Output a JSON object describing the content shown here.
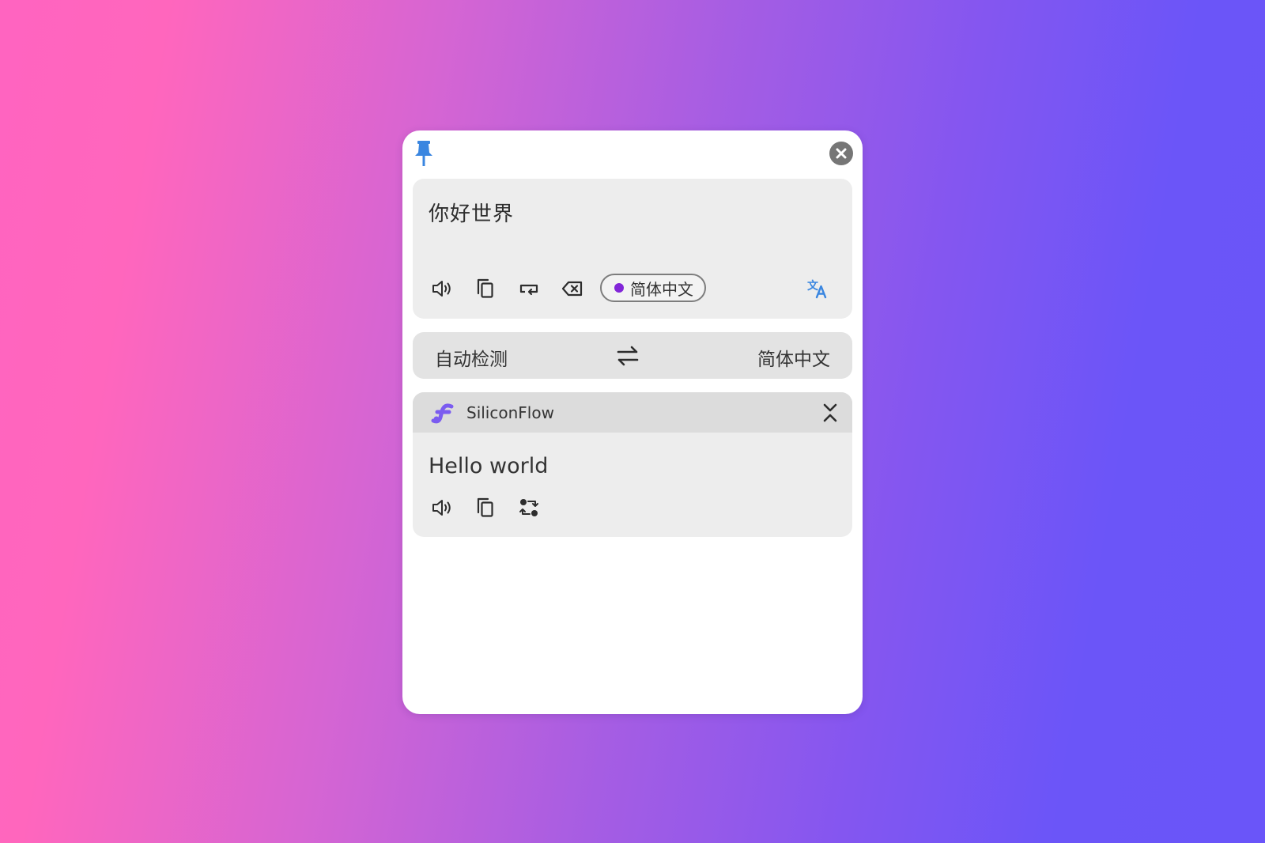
{
  "source": {
    "text": "你好世界",
    "detected_language": "简体中文"
  },
  "language_bar": {
    "from": "自动检测",
    "to": "简体中文"
  },
  "result": {
    "engine_name": "SiliconFlow",
    "text": "Hello world"
  },
  "colors": {
    "accent": "#3a86e0",
    "language_dot": "#8226d8",
    "engine_logo": "#7b5cf0",
    "close_button": "#767676"
  },
  "icons": {
    "pin": "pin-icon",
    "close": "close-icon",
    "speak": "speaker-icon",
    "copy": "copy-icon",
    "line_break": "line-break-icon",
    "clear": "backspace-clear-icon",
    "translate": "translate-icon",
    "swap": "swap-arrows-icon",
    "collapse": "collapse-icon",
    "retranslate": "retranslate-icon"
  }
}
